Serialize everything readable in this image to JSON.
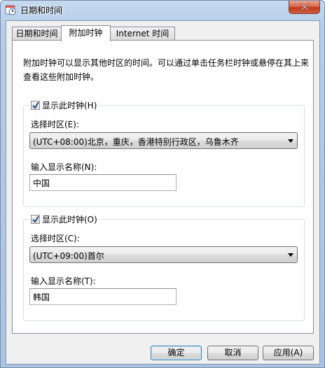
{
  "window": {
    "title": "日期和时间",
    "icon": "clock-calendar-icon"
  },
  "tabs": [
    {
      "label": "日期和时间",
      "active": false
    },
    {
      "label": "附加时钟",
      "active": true
    },
    {
      "label": "Internet 时间",
      "active": false
    }
  ],
  "description": "附加时钟可以显示其他时区的时间。可以通过单击任务栏时钟或悬停在其上来查看这些附加时钟。",
  "clocks": [
    {
      "show_label": "显示此时钟(H)",
      "checked": true,
      "timezone_label": "选择时区(E):",
      "timezone_value": "(UTC+08:00)北京，重庆，香港特别行政区，乌鲁木齐",
      "name_label": "输入显示名称(N):",
      "name_value": "中国"
    },
    {
      "show_label": "显示此时钟(O)",
      "checked": true,
      "timezone_label": "选择时区(C):",
      "timezone_value": "(UTC+09:00)首尔",
      "name_label": "输入显示名称(T):",
      "name_value": "韩国"
    }
  ],
  "buttons": {
    "ok": "确定",
    "cancel": "取消",
    "apply": "应用(A)"
  },
  "colors": {
    "titlebar": "#b6cde8",
    "close_button": "#c0391c",
    "panel_background": "#ffffff",
    "dialog_background": "#f0f0f0"
  }
}
